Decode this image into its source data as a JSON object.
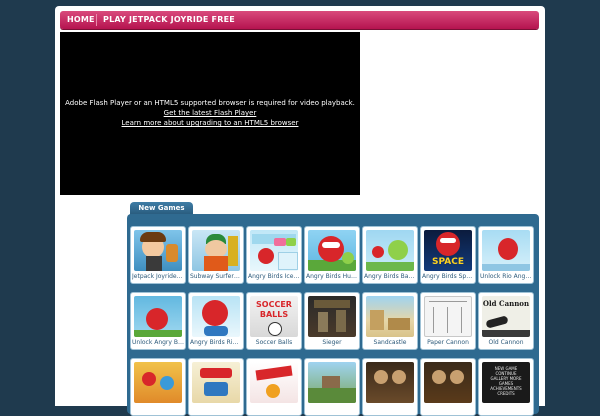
{
  "nav": {
    "home": "HOME",
    "play": "PLAY JETPACK JOYRIDE FREE"
  },
  "player": {
    "message": "Adobe Flash Player or an HTML5 supported browser is required for video playback.",
    "link_flash": "Get the latest Flash Player",
    "link_html5": "Learn more about upgrading to an HTML5 browser"
  },
  "new_games": {
    "tab_label": "New Games",
    "row1": [
      "Jetpack Joyride ...",
      "Subway Surfers ...",
      "Angry Birds Ice ...",
      "Angry Birds Hun...",
      "Angry Birds Bad ...",
      "Angry Birds Spa...",
      "Unlock Rio Angr..."
    ],
    "row2": [
      "Unlock Angry Bi...",
      "Angry Birds Rio ...",
      "Soccer Balls",
      "Sieger",
      "Sandcastle",
      "Paper Cannon",
      "Old Cannon"
    ]
  },
  "thumb_text": {
    "space": "SPACE",
    "soccer": "SOCCER BALLS",
    "old_cannon": "Old Cannon",
    "menu": "NEW GAME CONTINUE GALLERY MORE GAMES ACHIEVEMENTS CREDITS"
  },
  "colors": {
    "nav_pink": "#c21d5a",
    "panel_blue": "#2f6a90",
    "background": "#1f3a4e"
  }
}
